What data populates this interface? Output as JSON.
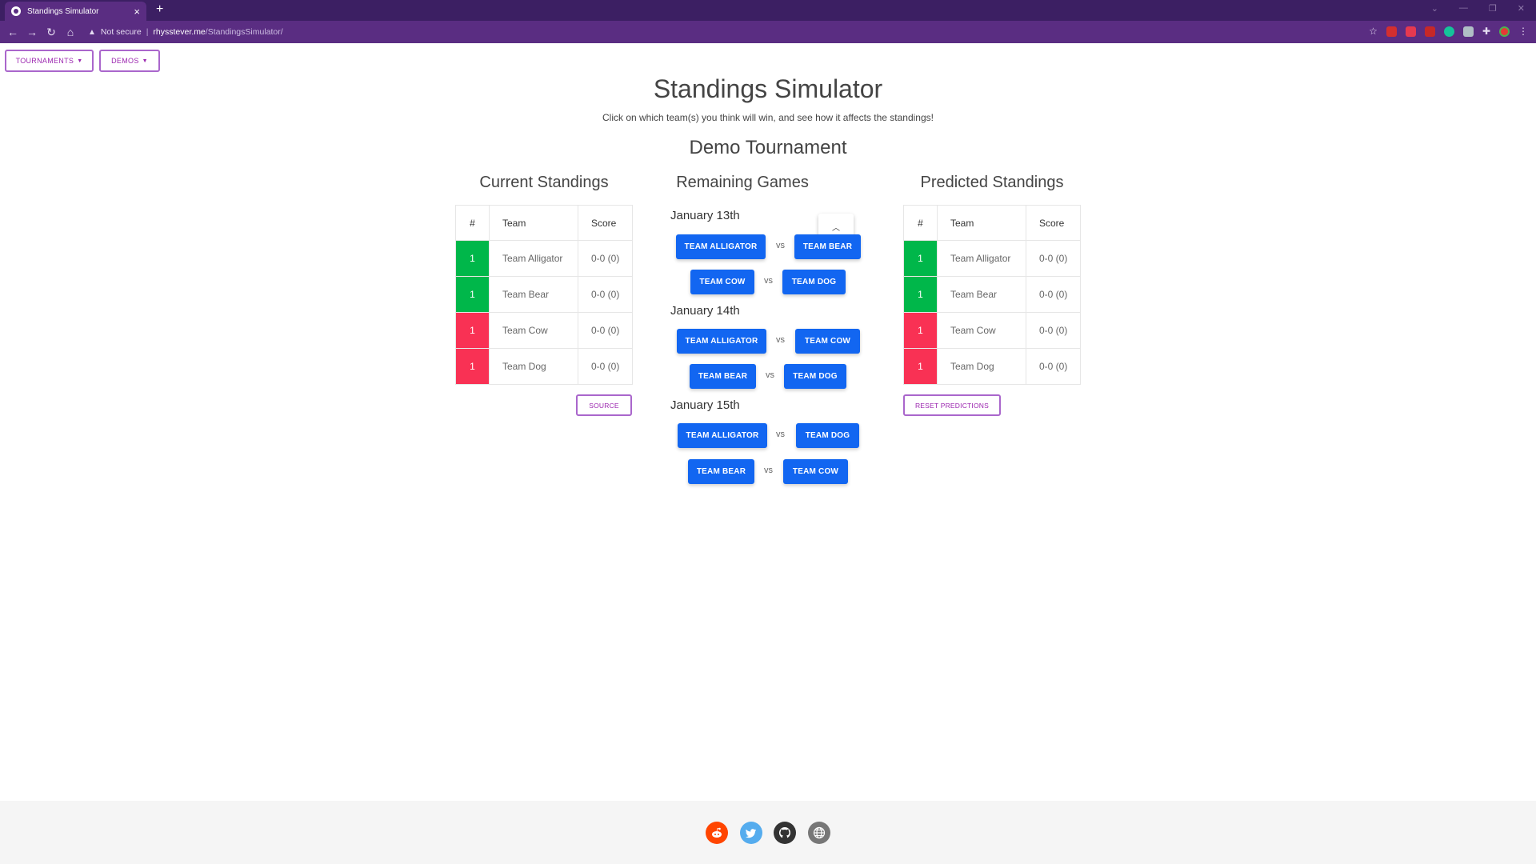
{
  "browser": {
    "tab_title": "Standings Simulator",
    "tab_close": "×",
    "new_tab": "+",
    "not_secure": "Not secure",
    "url_host": "rhysstever.me",
    "url_path": "/StandingsSimulator/"
  },
  "nav": {
    "tournaments": "TOURNAMENTS",
    "demos": "DEMOS"
  },
  "header": {
    "title": "Standings Simulator",
    "subtitle": "Click on which team(s) you think will win, and see how it affects the standings!",
    "tournament": "Demo Tournament"
  },
  "current": {
    "title": "Current Standings",
    "headers": [
      "#",
      "Team",
      "Score"
    ],
    "rows": [
      {
        "rank": "1",
        "team": "Team Alligator",
        "score": "0-0 (0)",
        "status": "green"
      },
      {
        "rank": "1",
        "team": "Team Bear",
        "score": "0-0 (0)",
        "status": "green"
      },
      {
        "rank": "1",
        "team": "Team Cow",
        "score": "0-0 (0)",
        "status": "red"
      },
      {
        "rank": "1",
        "team": "Team Dog",
        "score": "0-0 (0)",
        "status": "red"
      }
    ],
    "source_label": "SOURCE"
  },
  "remaining": {
    "title": "Remaining Games",
    "vs": "vs",
    "days": [
      {
        "label": "January 13th",
        "games": [
          [
            "TEAM ALLIGATOR",
            "TEAM BEAR"
          ],
          [
            "TEAM COW",
            "TEAM DOG"
          ]
        ]
      },
      {
        "label": "January 14th",
        "games": [
          [
            "TEAM ALLIGATOR",
            "TEAM COW"
          ],
          [
            "TEAM BEAR",
            "TEAM DOG"
          ]
        ]
      },
      {
        "label": "January 15th",
        "games": [
          [
            "TEAM ALLIGATOR",
            "TEAM DOG"
          ],
          [
            "TEAM BEAR",
            "TEAM COW"
          ]
        ]
      }
    ]
  },
  "predicted": {
    "title": "Predicted Standings",
    "headers": [
      "#",
      "Team",
      "Score"
    ],
    "rows": [
      {
        "rank": "1",
        "team": "Team Alligator",
        "score": "0-0 (0)",
        "status": "green"
      },
      {
        "rank": "1",
        "team": "Team Bear",
        "score": "0-0 (0)",
        "status": "green"
      },
      {
        "rank": "1",
        "team": "Team Cow",
        "score": "0-0 (0)",
        "status": "red"
      },
      {
        "rank": "1",
        "team": "Team Dog",
        "score": "0-0 (0)",
        "status": "red"
      }
    ],
    "reset_label": "RESET PREDICTIONS"
  },
  "colors": {
    "win": "#00b74a",
    "loss": "#f93154",
    "primary": "#1266f1",
    "accent": "#9c27b0"
  },
  "footer": {
    "icons": [
      "reddit-icon",
      "twitter-icon",
      "github-icon",
      "globe-icon"
    ]
  }
}
